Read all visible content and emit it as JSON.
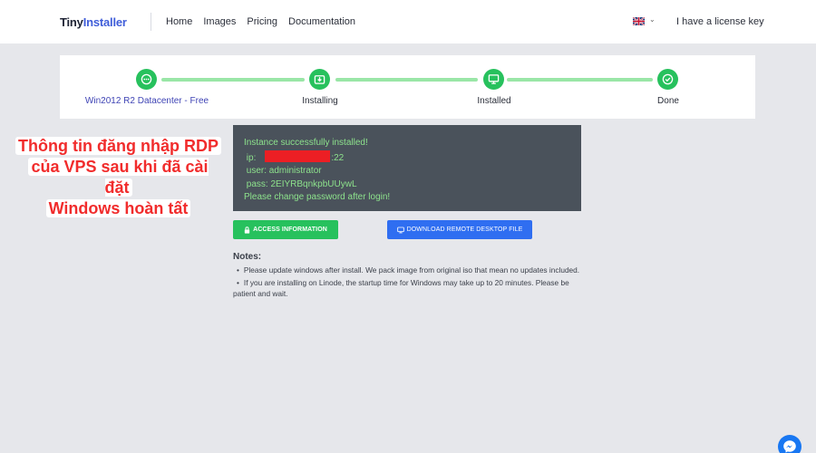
{
  "header": {
    "logo_part1": "Tiny",
    "logo_part2": "Installer",
    "nav": [
      "Home",
      "Images",
      "Pricing",
      "Documentation"
    ],
    "language_flag": "uk-flag-icon",
    "license_label": "I have a license key"
  },
  "stepper": {
    "steps": [
      {
        "label": "Win2012 R2 Datacenter - Free",
        "icon": "ellipsis-icon",
        "status": "done"
      },
      {
        "label": "Installing",
        "icon": "download-icon",
        "status": "done"
      },
      {
        "label": "Installed",
        "icon": "monitor-icon",
        "status": "done"
      },
      {
        "label": "Done",
        "icon": "check-icon",
        "status": "done"
      }
    ],
    "accent": "#27c15d",
    "line_color": "#9ae6a7"
  },
  "console": {
    "line1": "Instance successfully installed!",
    "ip_label": "ip:",
    "ip_suffix": ":22",
    "user_line": "user: administrator",
    "pass_line": "pass: 2EIYRBqnkpbUUywL",
    "warning": "Please change password after login!"
  },
  "callout": {
    "lines": [
      "Thông tin đăng nhập RDP",
      "của VPS sau khi đã cài đặt",
      "Windows hoàn tất"
    ]
  },
  "buttons": {
    "access": "ACCESS INFORMATION",
    "download": "DOWNLOAD REMOTE DESKTOP FILE"
  },
  "notes": {
    "title": "Notes:",
    "items": [
      "Please update windows after install. We pack image from original iso that mean no updates included.",
      "If you are installing on Linode, the startup time for Windows may take up to 20 minutes. Please be patient and wait."
    ]
  },
  "colors": {
    "green": "#27c15d",
    "blue": "#2f6ef1",
    "console_bg": "#4a525b",
    "console_text": "#8de28c",
    "callout_red": "#f12c2c"
  }
}
